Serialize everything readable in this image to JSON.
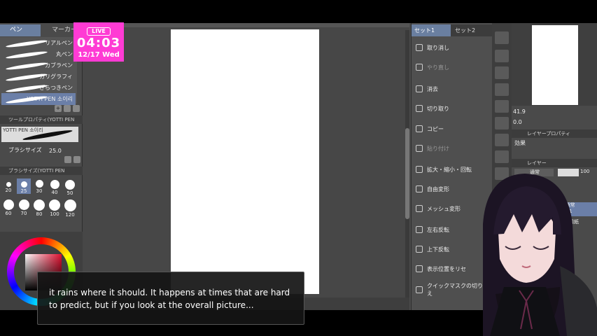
{
  "overlay": {
    "live_badge": "LIVE",
    "time": "04:03",
    "date": "12/17 Wed",
    "caption": "it rains where it should. It happens at times that are hard to predict, but if you look at the overall picture..."
  },
  "left_panel": {
    "tabs": [
      "ペン",
      "マーカー"
    ],
    "brushes": [
      "リアルペン",
      "丸ペン",
      "カブラペン",
      "カリグラフィ",
      "ざらつきペン",
      "YOTTI PEN 소이리"
    ],
    "tool_property_header": "ツールプロパティ(YOTTI PEN",
    "tool_preview_label": "YOTTI PEN 소이리",
    "brush_size_label": "ブラシサイズ",
    "brush_size_value": "25.0",
    "brush_size_header": "ブラシサイズ(YOTTI PEN",
    "sizes": [
      "20",
      "25",
      "30",
      "40",
      "50",
      "60",
      "70",
      "80",
      "100",
      "120"
    ]
  },
  "command_bar": {
    "set_tabs": [
      "セット1",
      "セット2"
    ],
    "items": [
      {
        "label": "取り消し",
        "dim": false
      },
      {
        "label": "やり直し",
        "dim": true
      },
      {
        "label": "消去",
        "dim": false
      },
      {
        "label": "切り取り",
        "dim": false
      },
      {
        "label": "コピー",
        "dim": false
      },
      {
        "label": "貼り付け",
        "dim": true
      },
      {
        "label": "拡大・縮小・回転",
        "dim": false
      },
      {
        "label": "自由変形",
        "dim": false
      },
      {
        "label": "メッシュ変形",
        "dim": false
      },
      {
        "label": "左右反転",
        "dim": false
      },
      {
        "label": "上下反転",
        "dim": false
      },
      {
        "label": "表示位置をリセ",
        "dim": false
      },
      {
        "label": "クイックマスクの切り替え",
        "dim": false
      }
    ]
  },
  "right_panel": {
    "zoom": "41.9",
    "rotation": "0.0",
    "layer_property_header": "レイヤープロパティ",
    "effect_label": "効果",
    "layer_header": "レイヤー",
    "blend_mode": "通常",
    "opacity": "100",
    "layers": [
      {
        "line1": "100 % 通常",
        "line2": "レイヤー 1"
      },
      {
        "line1": "用紙",
        "line2": ""
      }
    ]
  },
  "colors": {
    "accent": "#6a7fa0",
    "clock_bg": "#ff3bd4",
    "panel_bg": "#4a4a4a"
  }
}
